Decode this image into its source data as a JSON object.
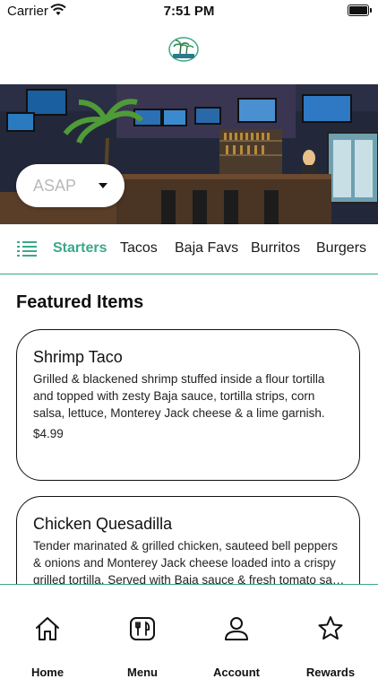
{
  "status_bar": {
    "carrier": "Carrier",
    "time": "7:51 PM"
  },
  "header": {
    "logo_icon": "restaurant-logo-icon"
  },
  "hero": {
    "image": "bar-interior-photo"
  },
  "order_time": {
    "value": "ASAP",
    "icon": "caret-down-icon"
  },
  "categories": {
    "menu_icon": "list-icon",
    "tabs": [
      {
        "label": "Starters",
        "active": true
      },
      {
        "label": "Tacos",
        "active": false
      },
      {
        "label": "Baja Favs",
        "active": false
      },
      {
        "label": "Burritos",
        "active": false
      },
      {
        "label": "Burgers",
        "active": false
      }
    ]
  },
  "featured": {
    "title": "Featured Items",
    "items": [
      {
        "name": "Shrimp Taco",
        "description": "Grilled & blackened shrimp stuffed inside a flour tortilla and topped with zesty Baja sauce, tortilla strips, corn salsa, lettuce, Monterey Jack cheese & a lime garnish.",
        "price": "$4.99"
      },
      {
        "name": "Chicken Quesadilla",
        "description": "Tender marinated & grilled chicken, sauteed bell peppers & onions and Monterey Jack cheese loaded into a crispy grilled tortilla.  Served with Baja sauce & fresh tomato sa…"
      }
    ]
  },
  "tab_bar": {
    "items": [
      {
        "label": "Home",
        "icon": "home-icon"
      },
      {
        "label": "Menu",
        "icon": "menu-utensils-icon"
      },
      {
        "label": "Account",
        "icon": "account-icon"
      },
      {
        "label": "Rewards",
        "icon": "star-icon"
      }
    ]
  },
  "colors": {
    "accent": "#3aa889",
    "text": "#111111",
    "placeholder": "#b9b9b9"
  }
}
